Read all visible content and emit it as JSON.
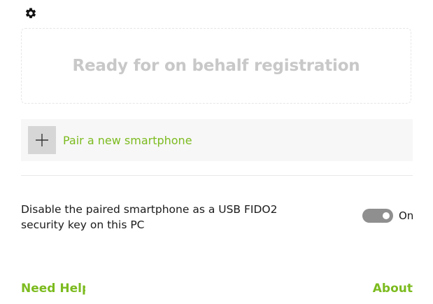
{
  "settings": {
    "icon": "gear-icon"
  },
  "status": {
    "text": "Ready for on behalf registration"
  },
  "pair": {
    "icon": "plus-icon",
    "label": "Pair a new smartphone"
  },
  "security_setting": {
    "description": "Disable the paired smartphone as a USB FIDO2 security key on this PC",
    "toggle_state": "On",
    "toggle_on": true
  },
  "footer": {
    "need_help": "Need Help",
    "about": "About"
  },
  "colors": {
    "accent": "#7cbb1f",
    "status_text": "#c8c8c8",
    "toggle_track": "#8f8f8f"
  }
}
